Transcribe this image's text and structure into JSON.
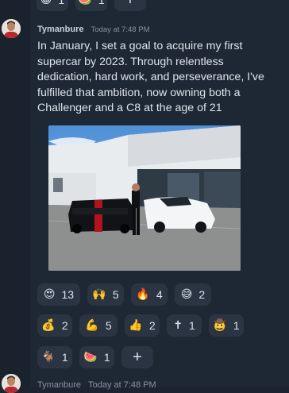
{
  "previous_reactions": [
    {
      "icon": "happy-face",
      "emoji": "😀",
      "count": "1"
    },
    {
      "icon": "watermelon",
      "emoji": "🍉",
      "count": "1"
    }
  ],
  "message": {
    "author": "Tymanbure",
    "timestamp": "Today at 7:48 PM",
    "text": "In January, I set a goal to acquire my first supercar by 2023. Through relentless dedication, hard work, and perseverance, I've fulfilled that ambition, now owning both a Challenger and a C8 at the age of 21",
    "attachment": "photo-black-challenger-white-c8-dealership"
  },
  "reactions_row1": [
    {
      "icon": "smiling-face-hearts",
      "emoji": "😍",
      "count": "13"
    },
    {
      "icon": "raised-hands",
      "emoji": "🙌",
      "count": "5"
    },
    {
      "icon": "fire-face",
      "emoji": "🔥",
      "count": "4"
    },
    {
      "icon": "sweat-smile",
      "emoji": "😅",
      "count": "2"
    }
  ],
  "reactions_row2": [
    {
      "icon": "money-bag",
      "emoji": "💰",
      "count": "2"
    },
    {
      "icon": "flexed-biceps",
      "emoji": "💪",
      "count": "5"
    },
    {
      "icon": "thumbs-up",
      "emoji": "👍",
      "count": "2"
    },
    {
      "icon": "latin-cross",
      "emoji": "✝",
      "count": "1"
    },
    {
      "icon": "cowboy-face",
      "emoji": "🤠",
      "count": "1"
    }
  ],
  "reactions_row3": [
    {
      "icon": "goat",
      "emoji": "🐐",
      "count": "1"
    },
    {
      "icon": "watermelon",
      "emoji": "🍉",
      "count": "1"
    }
  ],
  "next_message": {
    "author": "Tymanbure",
    "timestamp": "Today at 7:48 PM"
  },
  "colors": {
    "background": "#1e2835",
    "reaction_bg": "#2a3443",
    "text": "#dde3ea",
    "muted": "#8791a0"
  }
}
